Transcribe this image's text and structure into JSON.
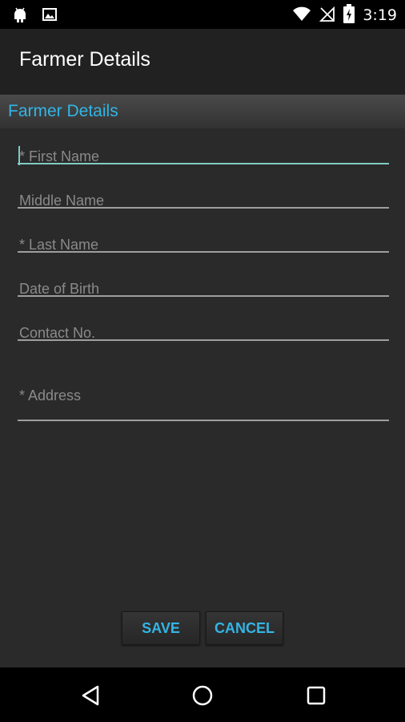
{
  "status_bar": {
    "time": "3:19",
    "icons": [
      "android-icon",
      "image-icon",
      "wifi-icon",
      "no-signal-icon",
      "battery-charging-icon"
    ]
  },
  "app_bar": {
    "title": "Farmer Details"
  },
  "section": {
    "title": "Farmer Details"
  },
  "form": {
    "first_name": {
      "placeholder": "* First Name",
      "value": ""
    },
    "middle_name": {
      "placeholder": "Middle Name",
      "value": ""
    },
    "last_name": {
      "placeholder": "* Last Name",
      "value": ""
    },
    "dob": {
      "placeholder": "Date of Birth",
      "value": ""
    },
    "contact": {
      "placeholder": "Contact No.",
      "value": ""
    },
    "address": {
      "placeholder": "* Address",
      "value": ""
    }
  },
  "actions": {
    "save_label": "SAVE",
    "cancel_label": "CANCEL"
  },
  "nav_bar": {
    "icons": [
      "back-icon",
      "home-icon",
      "recents-icon"
    ]
  },
  "colors": {
    "accent": "#33b5e5",
    "focus": "#80cbc4",
    "background": "#2a2a2a",
    "app_bar": "#212121"
  }
}
